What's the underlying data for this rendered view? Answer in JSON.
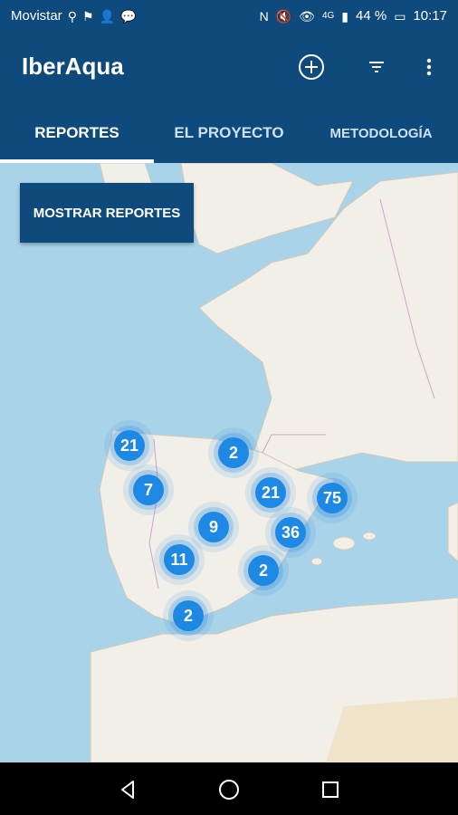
{
  "status": {
    "carrier": "Movistar",
    "left_icons": [
      "usb-icon",
      "flag-icon",
      "person-add-icon",
      "chat-icon"
    ],
    "right_icons": [
      "nfc-icon",
      "mute-icon",
      "eye-icon",
      "signal-icon"
    ],
    "network": "4G",
    "battery": "44 %",
    "time": "10:17"
  },
  "app": {
    "title": "IberAqua",
    "actions": [
      "add-circle-icon",
      "filter-icon",
      "more-vert-icon"
    ]
  },
  "tabs": [
    {
      "label": "REPORTES",
      "active": true
    },
    {
      "label": "EL PROYECTO",
      "active": false
    },
    {
      "label": "METODOLOGÍA",
      "active": false
    }
  ],
  "map": {
    "button_label": "MOSTRAR REPORTES",
    "clusters": [
      "21",
      "2",
      "7",
      "21",
      "75",
      "9",
      "36",
      "11",
      "2",
      "2"
    ],
    "colors": {
      "sea": "#a9d3e8",
      "land": "#f2efe9",
      "cluster": "#1e88e5",
      "appbar": "#0f4a7c"
    }
  },
  "navbar": {
    "buttons": [
      "back-icon",
      "home-icon",
      "recents-icon"
    ]
  }
}
